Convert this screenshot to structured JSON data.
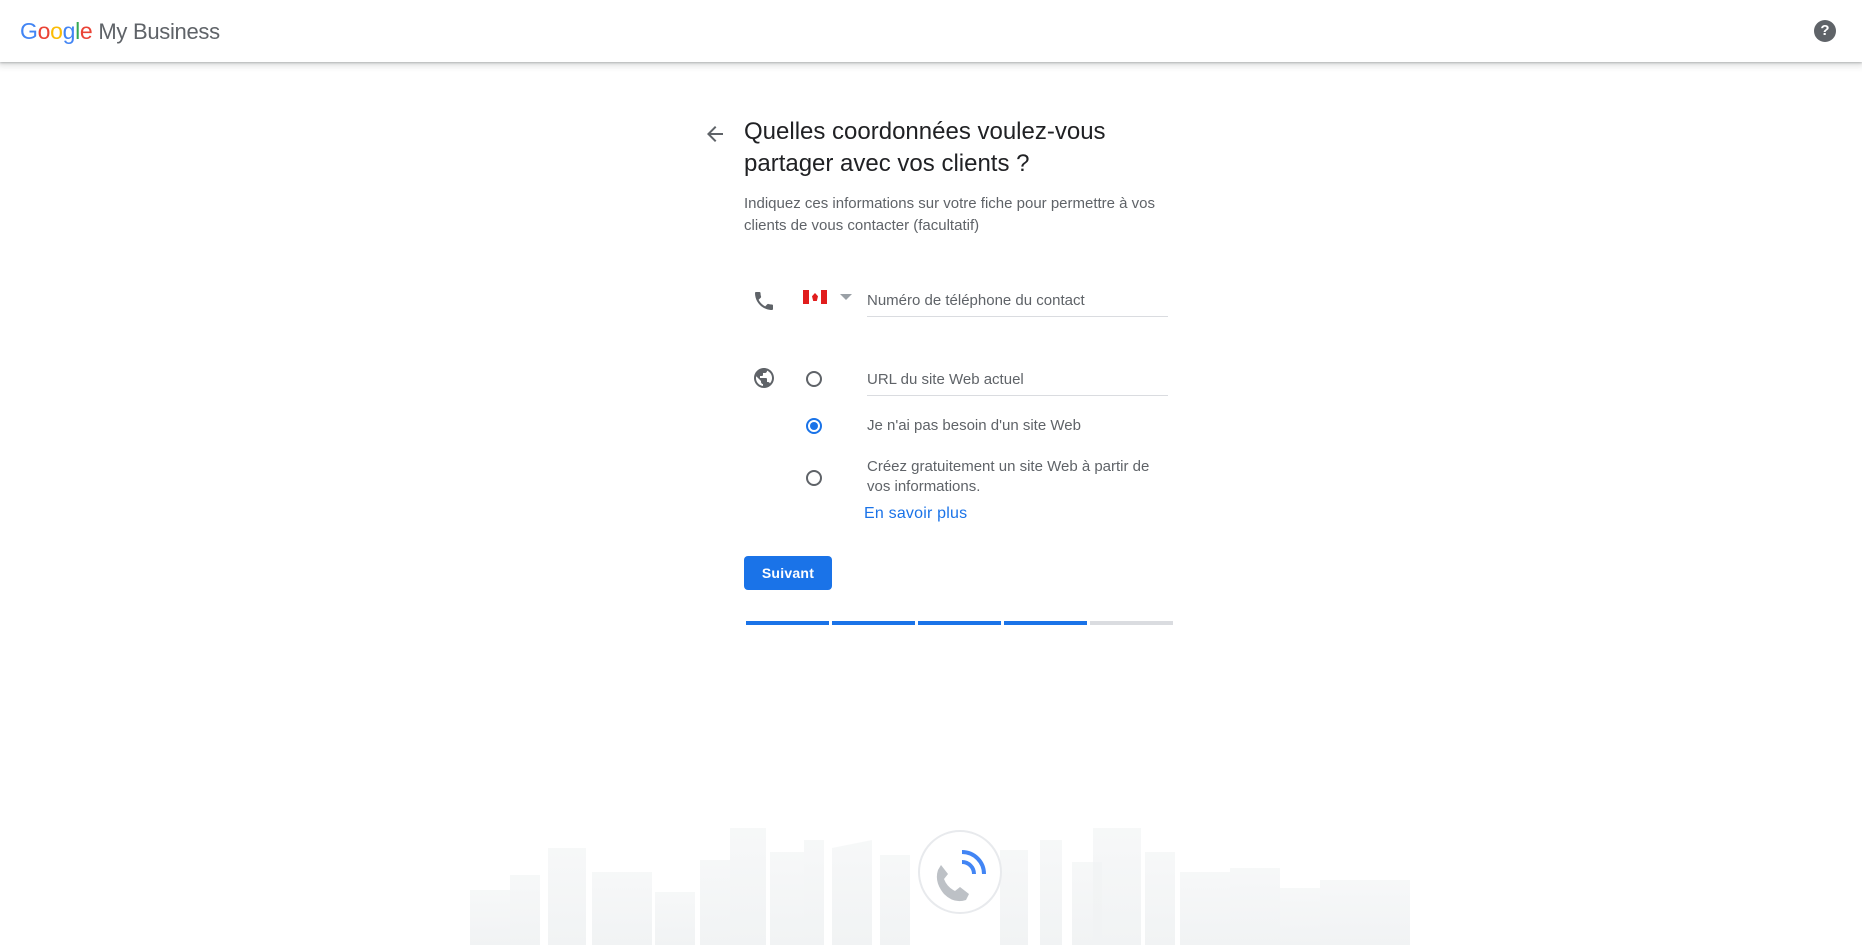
{
  "header": {
    "brand_letters": [
      "G",
      "o",
      "o",
      "g",
      "l",
      "e"
    ],
    "brand_colors": [
      "#4285F4",
      "#EA4335",
      "#FBBC05",
      "#4285F4",
      "#34A853",
      "#EA4335"
    ],
    "product_name": "My Business",
    "help_label": "?",
    "help_icon": "help-circle-icon"
  },
  "page": {
    "back_icon": "arrow-back-icon",
    "title": "Quelles coordonnées voulez-vous partager avec vos clients ?",
    "subtitle": "Indiquez ces informations sur votre fiche pour permettre à vos clients de vous contacter (facultatif)"
  },
  "phone": {
    "icon": "phone-icon",
    "country_flag_icon": "canada-flag-icon",
    "placeholder": "Numéro de téléphone du contact",
    "value": ""
  },
  "website": {
    "icon": "globe-icon",
    "url_placeholder": "URL du site Web actuel",
    "url_value": "",
    "options": [
      {
        "label": "",
        "checked": false
      },
      {
        "label": "Je n'ai pas besoin d'un site Web",
        "checked": true
      },
      {
        "label": "Créez gratuitement un site Web à partir de vos informations.",
        "checked": false
      }
    ],
    "learn_more": "En savoir plus"
  },
  "actions": {
    "next_label": "Suivant"
  },
  "progress": {
    "total_steps": 5,
    "completed_steps": 4
  },
  "colors": {
    "accent": "#1a73e8",
    "text_secondary": "#5f6368",
    "divider": "#dadce0"
  }
}
